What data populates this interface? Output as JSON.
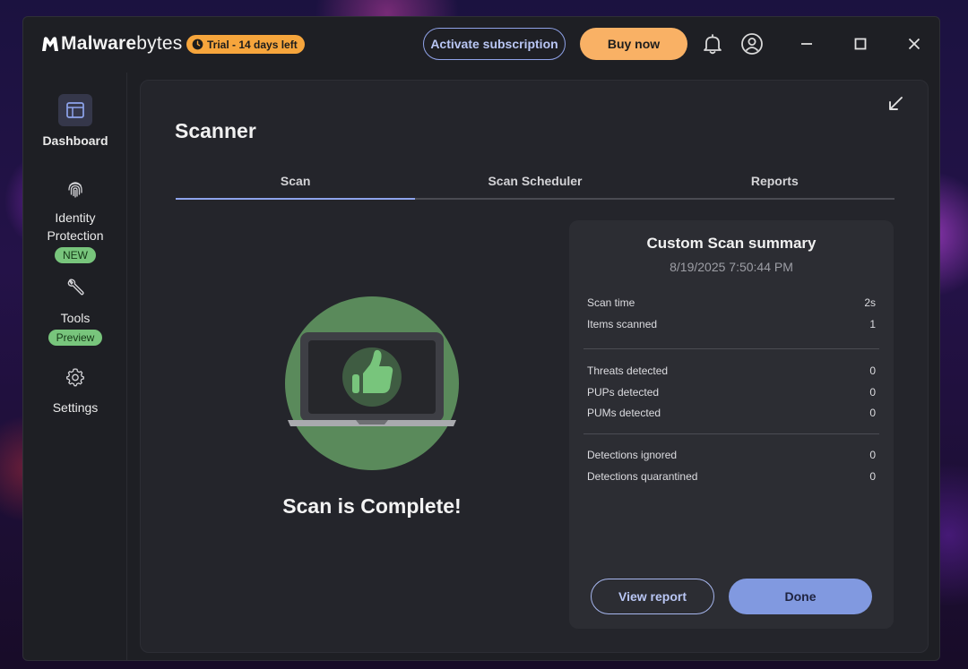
{
  "app": {
    "brand_bold": "Malware",
    "brand_light": "bytes",
    "trial_label": "Trial - 14 days left",
    "activate_label": "Activate subscription",
    "buy_label": "Buy now"
  },
  "sidebar": {
    "items": [
      {
        "label": "Dashboard",
        "icon": "dashboard-icon",
        "active": true
      },
      {
        "label": "Identity Protection",
        "icon": "fingerprint-icon",
        "badge": "NEW"
      },
      {
        "label": "Tools",
        "icon": "wrench-icon",
        "badge": "Preview"
      },
      {
        "label": "Settings",
        "icon": "gear-icon"
      }
    ]
  },
  "scanner": {
    "title": "Scanner",
    "tabs": [
      {
        "label": "Scan",
        "active": true
      },
      {
        "label": "Scan Scheduler"
      },
      {
        "label": "Reports"
      }
    ],
    "status": "Scan is Complete!"
  },
  "summary": {
    "title": "Custom Scan summary",
    "date": "8/19/2025 7:50:44 PM",
    "groups": [
      [
        {
          "label": "Scan time",
          "value": "2s"
        },
        {
          "label": "Items scanned",
          "value": "1"
        }
      ],
      [
        {
          "label": "Threats detected",
          "value": "0"
        },
        {
          "label": "PUPs detected",
          "value": "0"
        },
        {
          "label": "PUMs detected",
          "value": "0"
        }
      ],
      [
        {
          "label": "Detections ignored",
          "value": "0"
        },
        {
          "label": "Detections quarantined",
          "value": "0"
        }
      ]
    ],
    "view_report_label": "View report",
    "done_label": "Done"
  },
  "colors": {
    "accent": "#8199e0",
    "trial": "#f6a53c",
    "buy": "#f9b165",
    "badge_green": "#78c57c",
    "illustration_green": "#5a8a5b"
  }
}
